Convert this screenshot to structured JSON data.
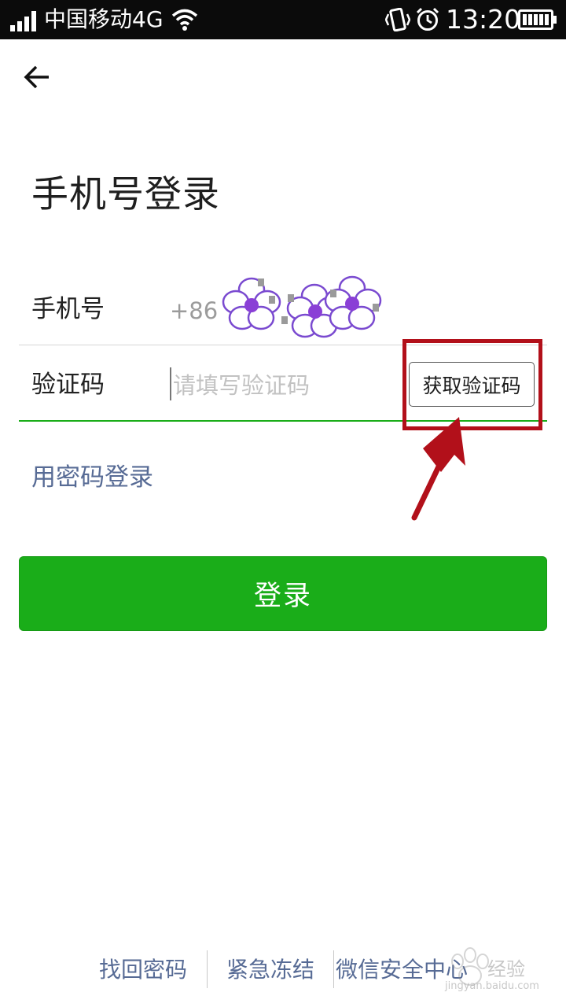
{
  "status_bar": {
    "carrier": "中国移动4G",
    "time": "13:20",
    "icons": [
      "signal-icon",
      "wifi-icon",
      "vibrate-icon",
      "alarm-icon",
      "battery-icon"
    ]
  },
  "nav": {
    "back_icon": "arrow-left-icon"
  },
  "page": {
    "title": "手机号登录"
  },
  "form": {
    "phone_label": "手机号",
    "phone_prefix": "+86",
    "code_label": "验证码",
    "code_placeholder": "请填写验证码",
    "code_value": "",
    "get_code_label": "获取验证码"
  },
  "links": {
    "password_login": "用密码登录"
  },
  "login_button": {
    "label": "登录"
  },
  "footer": {
    "links": [
      "找回密码",
      "紧急冻结",
      "微信安全中心"
    ]
  },
  "watermark": {
    "text": "经验",
    "url": "jingyan.baidu.com"
  },
  "colors": {
    "accent_green": "#1aad19",
    "link_blue": "#576b95",
    "annotation_red": "#b2101a",
    "status_bar_bg": "#0b0b0b"
  }
}
